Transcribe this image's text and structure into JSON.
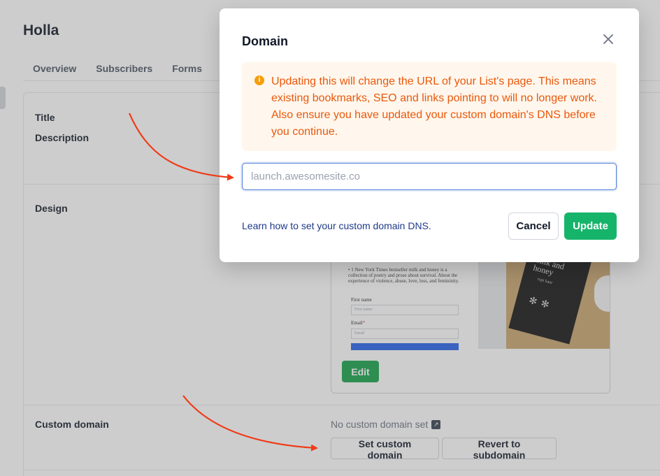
{
  "app": {
    "title": "Holla"
  },
  "tabs": [
    {
      "label": "Overview"
    },
    {
      "label": "Subscribers"
    },
    {
      "label": "Forms"
    }
  ],
  "settings": {
    "title_label": "Title",
    "description_label": "Description",
    "design_label": "Design",
    "custom_domain_label": "Custom domain",
    "no_custom_domain": "No custom domain set",
    "set_custom_domain_button": "Set custom domain",
    "revert_button": "Revert to subdomain",
    "edit_button": "Edit"
  },
  "preview": {
    "description": "• 1 New York Times bestseller milk and honey is a collection of poetry and prose about survival. About the experience of violence, abuse, love, loss, and femininity.",
    "first_name_label": "First name",
    "first_name_placeholder": "First name",
    "email_label": "Email",
    "email_required": "*",
    "email_placeholder": "Email",
    "book_title": "milk and honey",
    "book_author": "rupi kaur"
  },
  "modal": {
    "title": "Domain",
    "warning": "Updating this will change the URL of your List's page. This means existing bookmarks, SEO and links pointing to will no longer work. Also ensure you have updated your custom domain's DNS before you continue.",
    "input_placeholder": "launch.awesomesite.co",
    "learn_link": "Learn how to set your custom domain DNS",
    "learn_link_suffix": ".",
    "cancel_label": "Cancel",
    "update_label": "Update"
  },
  "colors": {
    "primary_green": "#16b46b",
    "warning_text": "#ea580c",
    "warning_bg": "#fff7ed",
    "annotation_arrow": "#f03a17",
    "link": "#1e3a8a"
  },
  "icons": {
    "close": "close-icon",
    "warning": "info-icon",
    "external": "external-link-icon"
  }
}
